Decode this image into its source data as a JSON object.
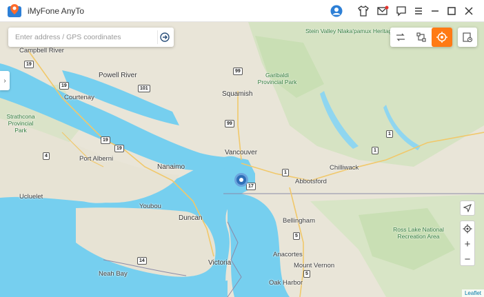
{
  "app": {
    "title": "iMyFone AnyTo"
  },
  "titlebar": {
    "icons": [
      "avatar-icon",
      "tshirt-icon",
      "mail-icon",
      "feedback-icon",
      "menu-icon",
      "minimize-icon",
      "maximize-icon",
      "close-icon"
    ]
  },
  "search": {
    "placeholder": "Enter address / GPS coordinates"
  },
  "modes": [
    "two-spot-mode-icon",
    "multi-spot-mode-icon",
    "teleport-mode-icon",
    "history-icon"
  ],
  "map": {
    "places": [
      "Stein Valley Nlaka'pamux Heritage Park",
      "Campbell River",
      "Powell River",
      "Courtenay",
      "Garibaldi Provincial Park",
      "Squamish",
      "Strathcona Provincial Park",
      "Port Alberni",
      "Nanaimo",
      "Vancouver",
      "Chilliwack",
      "Abbotsford",
      "Ucluelet",
      "Youbou",
      "Duncan",
      "Bellingham",
      "Ross Lake National Recreation Area",
      "Victoria",
      "Anacortes",
      "Mount Vernon",
      "Neah Bay",
      "Oak Harbor"
    ],
    "route_shields": [
      "19",
      "19",
      "19",
      "19",
      "99",
      "101",
      "99",
      "4",
      "1",
      "1",
      "17",
      "1",
      "14",
      "5",
      "5"
    ],
    "attribution": "Leaflet",
    "water_color": "#76cfef",
    "land_color": "#e9e5d8",
    "forest_color": "#c9dfb4"
  }
}
